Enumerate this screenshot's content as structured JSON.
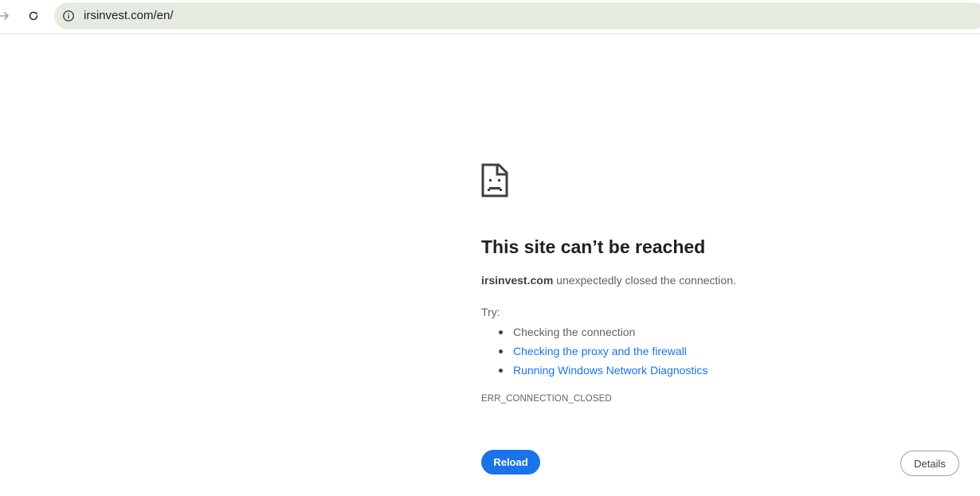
{
  "toolbar": {
    "forward_icon": "arrow-right-icon",
    "reload_icon": "reload-icon",
    "site_info_icon": "info-icon",
    "url": "irsinvest.com/en/"
  },
  "error_page": {
    "icon": "sad-page-icon",
    "headline": "This site can’t be reached",
    "summary_host": "irsinvest.com",
    "summary_rest": " unexpectedly closed the connection.",
    "try_label": "Try:",
    "suggestions": [
      {
        "label": "Checking the connection",
        "is_link": false
      },
      {
        "label": "Checking the proxy and the firewall",
        "is_link": true
      },
      {
        "label": "Running Windows Network Diagnostics",
        "is_link": true
      }
    ],
    "error_code": "ERR_CONNECTION_CLOSED",
    "reload_label": "Reload",
    "details_label": "Details"
  },
  "colors": {
    "omnibox_bg": "#e6ebdf",
    "link": "#1a73e8",
    "primary_button": "#1a73e8",
    "text_secondary": "#5f6368"
  }
}
